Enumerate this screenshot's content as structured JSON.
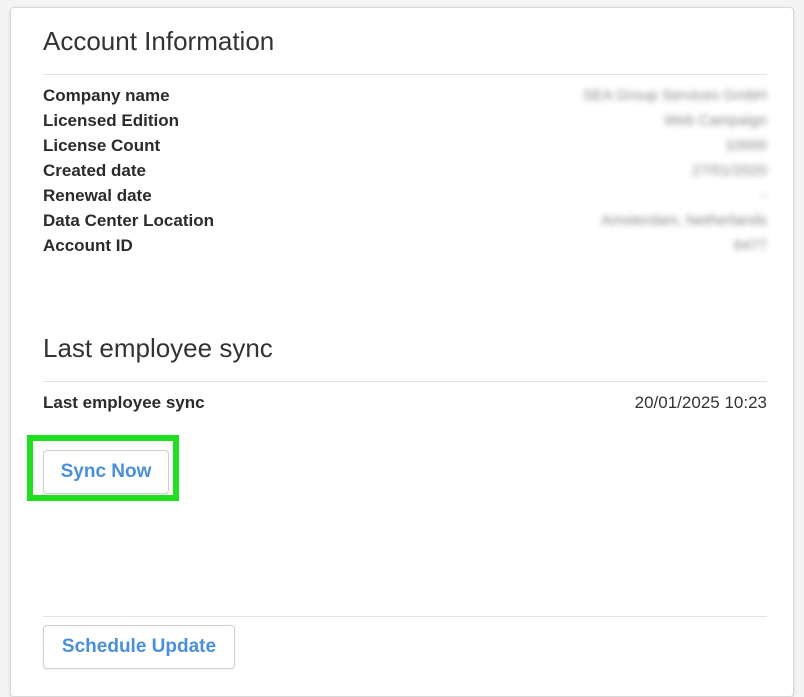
{
  "account": {
    "title": "Account Information",
    "fields": [
      {
        "label": "Company name",
        "value": "SEA Group Services GmbH"
      },
      {
        "label": "Licensed Edition",
        "value": "Web Campaign"
      },
      {
        "label": "License Count",
        "value": "10000"
      },
      {
        "label": "Created date",
        "value": "27/01/2020"
      },
      {
        "label": "Renewal date",
        "value": "-"
      },
      {
        "label": "Data Center Location",
        "value": "Amsterdam, Netherlands"
      },
      {
        "label": "Account ID",
        "value": "6477"
      }
    ]
  },
  "sync": {
    "title": "Last employee sync",
    "row_label": "Last employee sync",
    "row_value": "20/01/2025 10:23",
    "sync_now_label": "Sync Now"
  },
  "footer": {
    "schedule_label": "Schedule Update"
  },
  "colors": {
    "accent": "#4a90d9",
    "highlight": "#1ee01e"
  }
}
